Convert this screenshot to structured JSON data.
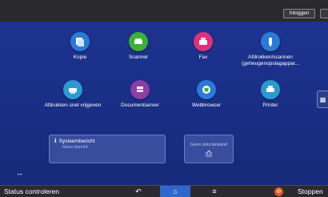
{
  "header": {
    "login_label": "Inloggen"
  },
  "apps": [
    {
      "label": "Kopie",
      "icon": "copy-icon",
      "color": "#2a7bd8"
    },
    {
      "label": "Scanner",
      "icon": "scanner-icon",
      "color": "#3fae3a"
    },
    {
      "label": "Fax",
      "icon": "fax-icon",
      "color": "#e0307a"
    },
    {
      "label": "Afdrukken/scannen",
      "label2": "(geheugenopslagappar...",
      "icon": "usb-icon",
      "color": "#2a7bd8"
    },
    {
      "label": "Afdrukken snel vrijgeven",
      "icon": "quick-print-icon",
      "color": "#2a9ad0"
    },
    {
      "label": "Documentserver",
      "icon": "document-server-icon",
      "color": "#8a3fa8"
    },
    {
      "label": "Webbrowser",
      "icon": "globe-icon",
      "color": "#2a7bd8"
    },
    {
      "label": "Printer",
      "icon": "printer-icon",
      "color": "#2a9ad0"
    }
  ],
  "widgets": {
    "system_message_title": "Systeembericht",
    "system_message_sub": "Geen bericht",
    "fax_received_title": "Geen ontv.bestand"
  },
  "bottom_bar": {
    "status_label": "Status controleren",
    "stop_label": "Stoppen"
  }
}
